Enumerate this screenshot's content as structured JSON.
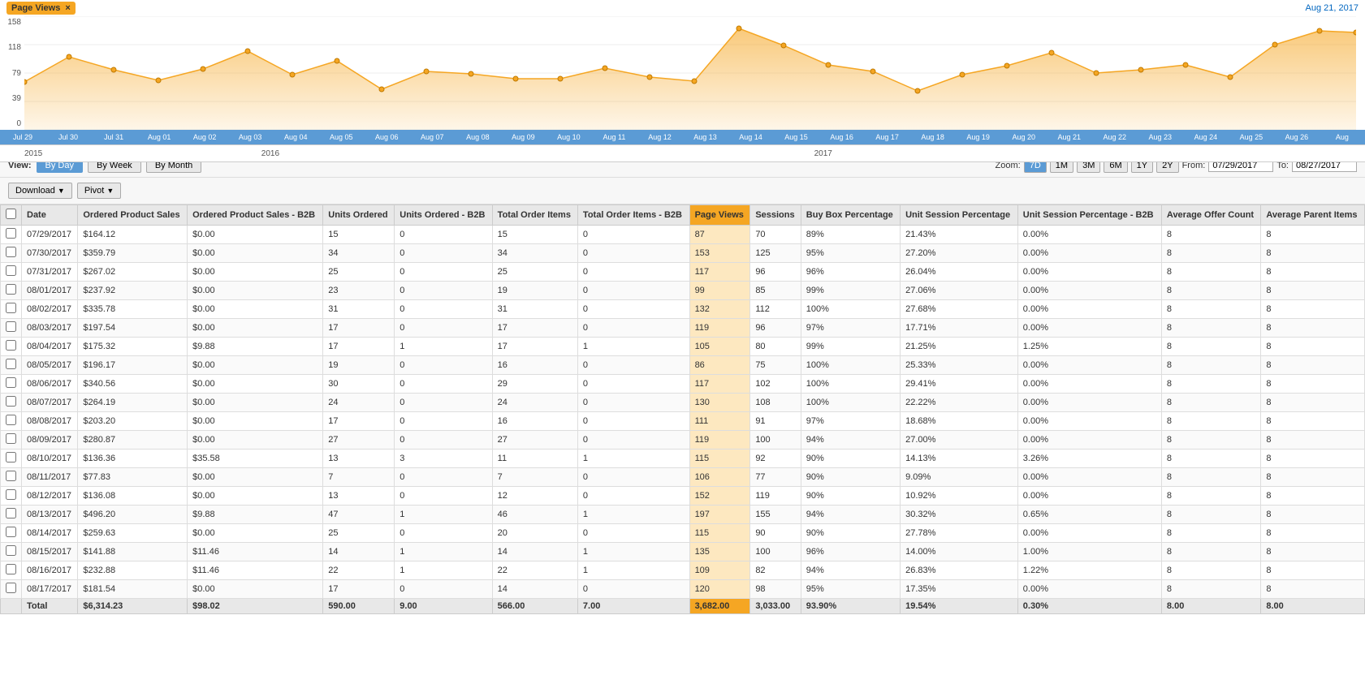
{
  "header": {
    "badge_label": "Page Views",
    "badge_close": "×",
    "date": "Aug 21, 2017"
  },
  "chart": {
    "y_labels": [
      "158",
      "118",
      "79",
      "39",
      "0"
    ],
    "x_labels": [
      "Jul 29",
      "Jul 30",
      "Jul 31",
      "Aug 01",
      "Aug 02",
      "Aug 03",
      "Aug 04",
      "Aug 05",
      "Aug 06",
      "Aug 07",
      "Aug 08",
      "Aug 09",
      "Aug 10",
      "Aug 11",
      "Aug 12",
      "Aug 13",
      "Aug 14",
      "Aug 15",
      "Aug 16",
      "Aug 17",
      "Aug 18",
      "Aug 19",
      "Aug 20",
      "Aug 21",
      "Aug 22",
      "Aug 23",
      "Aug 24",
      "Aug 25",
      "Aug 26",
      "Aug"
    ]
  },
  "year_axis": {
    "years": [
      {
        "label": "2015",
        "width": "18%"
      },
      {
        "label": "2016",
        "width": "42%"
      },
      {
        "label": "2017",
        "width": "38%"
      }
    ]
  },
  "view": {
    "label": "View:",
    "buttons": [
      {
        "label": "By Day",
        "active": true
      },
      {
        "label": "By Week",
        "active": false
      },
      {
        "label": "By Month",
        "active": false
      }
    ]
  },
  "zoom": {
    "label": "Zoom:",
    "buttons": [
      {
        "label": "7D",
        "active": true
      },
      {
        "label": "1M",
        "active": false
      },
      {
        "label": "3M",
        "active": false
      },
      {
        "label": "6M",
        "active": false
      },
      {
        "label": "1Y",
        "active": false
      },
      {
        "label": "2Y",
        "active": false
      }
    ],
    "from_label": "From:",
    "from_value": "07/29/2017",
    "to_label": "To:",
    "to_value": "08/27/2017"
  },
  "toolbar": {
    "download_label": "Download",
    "pivot_label": "Pivot"
  },
  "table": {
    "columns": [
      {
        "key": "check",
        "label": "",
        "highlight": false
      },
      {
        "key": "date",
        "label": "Date",
        "highlight": false
      },
      {
        "key": "ordered_product_sales",
        "label": "Ordered Product Sales",
        "highlight": false
      },
      {
        "key": "ordered_product_sales_b2b",
        "label": "Ordered Product Sales - B2B",
        "highlight": false
      },
      {
        "key": "units_ordered",
        "label": "Units Ordered",
        "highlight": false
      },
      {
        "key": "units_ordered_b2b",
        "label": "Units Ordered - B2B",
        "highlight": false
      },
      {
        "key": "total_order_items",
        "label": "Total Order Items",
        "highlight": false
      },
      {
        "key": "total_order_items_b2b",
        "label": "Total Order Items - B2B",
        "highlight": false
      },
      {
        "key": "page_views",
        "label": "Page Views",
        "highlight": true
      },
      {
        "key": "sessions",
        "label": "Sessions",
        "highlight": false
      },
      {
        "key": "buy_box_percentage",
        "label": "Buy Box Percentage",
        "highlight": false
      },
      {
        "key": "unit_session_percentage",
        "label": "Unit Session Percentage",
        "highlight": false
      },
      {
        "key": "unit_session_percentage_b2b",
        "label": "Unit Session Percentage - B2B",
        "highlight": false
      },
      {
        "key": "average_offer_count",
        "label": "Average Offer Count",
        "highlight": false
      },
      {
        "key": "average_parent_items",
        "label": "Average Parent Items",
        "highlight": false
      }
    ],
    "rows": [
      {
        "date": "07/29/2017",
        "ordered_product_sales": "$164.12",
        "ordered_product_sales_b2b": "$0.00",
        "units_ordered": "15",
        "units_ordered_b2b": "0",
        "total_order_items": "15",
        "total_order_items_b2b": "0",
        "page_views": "87",
        "sessions": "70",
        "buy_box_percentage": "89%",
        "unit_session_percentage": "21.43%",
        "unit_session_percentage_b2b": "0.00%",
        "average_offer_count": "8",
        "average_parent_items": "8"
      },
      {
        "date": "07/30/2017",
        "ordered_product_sales": "$359.79",
        "ordered_product_sales_b2b": "$0.00",
        "units_ordered": "34",
        "units_ordered_b2b": "0",
        "total_order_items": "34",
        "total_order_items_b2b": "0",
        "page_views": "153",
        "sessions": "125",
        "buy_box_percentage": "95%",
        "unit_session_percentage": "27.20%",
        "unit_session_percentage_b2b": "0.00%",
        "average_offer_count": "8",
        "average_parent_items": "8"
      },
      {
        "date": "07/31/2017",
        "ordered_product_sales": "$267.02",
        "ordered_product_sales_b2b": "$0.00",
        "units_ordered": "25",
        "units_ordered_b2b": "0",
        "total_order_items": "25",
        "total_order_items_b2b": "0",
        "page_views": "117",
        "sessions": "96",
        "buy_box_percentage": "96%",
        "unit_session_percentage": "26.04%",
        "unit_session_percentage_b2b": "0.00%",
        "average_offer_count": "8",
        "average_parent_items": "8"
      },
      {
        "date": "08/01/2017",
        "ordered_product_sales": "$237.92",
        "ordered_product_sales_b2b": "$0.00",
        "units_ordered": "23",
        "units_ordered_b2b": "0",
        "total_order_items": "19",
        "total_order_items_b2b": "0",
        "page_views": "99",
        "sessions": "85",
        "buy_box_percentage": "99%",
        "unit_session_percentage": "27.06%",
        "unit_session_percentage_b2b": "0.00%",
        "average_offer_count": "8",
        "average_parent_items": "8"
      },
      {
        "date": "08/02/2017",
        "ordered_product_sales": "$335.78",
        "ordered_product_sales_b2b": "$0.00",
        "units_ordered": "31",
        "units_ordered_b2b": "0",
        "total_order_items": "31",
        "total_order_items_b2b": "0",
        "page_views": "132",
        "sessions": "112",
        "buy_box_percentage": "100%",
        "unit_session_percentage": "27.68%",
        "unit_session_percentage_b2b": "0.00%",
        "average_offer_count": "8",
        "average_parent_items": "8"
      },
      {
        "date": "08/03/2017",
        "ordered_product_sales": "$197.54",
        "ordered_product_sales_b2b": "$0.00",
        "units_ordered": "17",
        "units_ordered_b2b": "0",
        "total_order_items": "17",
        "total_order_items_b2b": "0",
        "page_views": "119",
        "sessions": "96",
        "buy_box_percentage": "97%",
        "unit_session_percentage": "17.71%",
        "unit_session_percentage_b2b": "0.00%",
        "average_offer_count": "8",
        "average_parent_items": "8"
      },
      {
        "date": "08/04/2017",
        "ordered_product_sales": "$175.32",
        "ordered_product_sales_b2b": "$9.88",
        "units_ordered": "17",
        "units_ordered_b2b": "1",
        "total_order_items": "17",
        "total_order_items_b2b": "1",
        "page_views": "105",
        "sessions": "80",
        "buy_box_percentage": "99%",
        "unit_session_percentage": "21.25%",
        "unit_session_percentage_b2b": "1.25%",
        "average_offer_count": "8",
        "average_parent_items": "8"
      },
      {
        "date": "08/05/2017",
        "ordered_product_sales": "$196.17",
        "ordered_product_sales_b2b": "$0.00",
        "units_ordered": "19",
        "units_ordered_b2b": "0",
        "total_order_items": "16",
        "total_order_items_b2b": "0",
        "page_views": "86",
        "sessions": "75",
        "buy_box_percentage": "100%",
        "unit_session_percentage": "25.33%",
        "unit_session_percentage_b2b": "0.00%",
        "average_offer_count": "8",
        "average_parent_items": "8"
      },
      {
        "date": "08/06/2017",
        "ordered_product_sales": "$340.56",
        "ordered_product_sales_b2b": "$0.00",
        "units_ordered": "30",
        "units_ordered_b2b": "0",
        "total_order_items": "29",
        "total_order_items_b2b": "0",
        "page_views": "117",
        "sessions": "102",
        "buy_box_percentage": "100%",
        "unit_session_percentage": "29.41%",
        "unit_session_percentage_b2b": "0.00%",
        "average_offer_count": "8",
        "average_parent_items": "8"
      },
      {
        "date": "08/07/2017",
        "ordered_product_sales": "$264.19",
        "ordered_product_sales_b2b": "$0.00",
        "units_ordered": "24",
        "units_ordered_b2b": "0",
        "total_order_items": "24",
        "total_order_items_b2b": "0",
        "page_views": "130",
        "sessions": "108",
        "buy_box_percentage": "100%",
        "unit_session_percentage": "22.22%",
        "unit_session_percentage_b2b": "0.00%",
        "average_offer_count": "8",
        "average_parent_items": "8"
      },
      {
        "date": "08/08/2017",
        "ordered_product_sales": "$203.20",
        "ordered_product_sales_b2b": "$0.00",
        "units_ordered": "17",
        "units_ordered_b2b": "0",
        "total_order_items": "16",
        "total_order_items_b2b": "0",
        "page_views": "111",
        "sessions": "91",
        "buy_box_percentage": "97%",
        "unit_session_percentage": "18.68%",
        "unit_session_percentage_b2b": "0.00%",
        "average_offer_count": "8",
        "average_parent_items": "8"
      },
      {
        "date": "08/09/2017",
        "ordered_product_sales": "$280.87",
        "ordered_product_sales_b2b": "$0.00",
        "units_ordered": "27",
        "units_ordered_b2b": "0",
        "total_order_items": "27",
        "total_order_items_b2b": "0",
        "page_views": "119",
        "sessions": "100",
        "buy_box_percentage": "94%",
        "unit_session_percentage": "27.00%",
        "unit_session_percentage_b2b": "0.00%",
        "average_offer_count": "8",
        "average_parent_items": "8"
      },
      {
        "date": "08/10/2017",
        "ordered_product_sales": "$136.36",
        "ordered_product_sales_b2b": "$35.58",
        "units_ordered": "13",
        "units_ordered_b2b": "3",
        "total_order_items": "11",
        "total_order_items_b2b": "1",
        "page_views": "115",
        "sessions": "92",
        "buy_box_percentage": "90%",
        "unit_session_percentage": "14.13%",
        "unit_session_percentage_b2b": "3.26%",
        "average_offer_count": "8",
        "average_parent_items": "8"
      },
      {
        "date": "08/11/2017",
        "ordered_product_sales": "$77.83",
        "ordered_product_sales_b2b": "$0.00",
        "units_ordered": "7",
        "units_ordered_b2b": "0",
        "total_order_items": "7",
        "total_order_items_b2b": "0",
        "page_views": "106",
        "sessions": "77",
        "buy_box_percentage": "90%",
        "unit_session_percentage": "9.09%",
        "unit_session_percentage_b2b": "0.00%",
        "average_offer_count": "8",
        "average_parent_items": "8"
      },
      {
        "date": "08/12/2017",
        "ordered_product_sales": "$136.08",
        "ordered_product_sales_b2b": "$0.00",
        "units_ordered": "13",
        "units_ordered_b2b": "0",
        "total_order_items": "12",
        "total_order_items_b2b": "0",
        "page_views": "152",
        "sessions": "119",
        "buy_box_percentage": "90%",
        "unit_session_percentage": "10.92%",
        "unit_session_percentage_b2b": "0.00%",
        "average_offer_count": "8",
        "average_parent_items": "8"
      },
      {
        "date": "08/13/2017",
        "ordered_product_sales": "$496.20",
        "ordered_product_sales_b2b": "$9.88",
        "units_ordered": "47",
        "units_ordered_b2b": "1",
        "total_order_items": "46",
        "total_order_items_b2b": "1",
        "page_views": "197",
        "sessions": "155",
        "buy_box_percentage": "94%",
        "unit_session_percentage": "30.32%",
        "unit_session_percentage_b2b": "0.65%",
        "average_offer_count": "8",
        "average_parent_items": "8"
      },
      {
        "date": "08/14/2017",
        "ordered_product_sales": "$259.63",
        "ordered_product_sales_b2b": "$0.00",
        "units_ordered": "25",
        "units_ordered_b2b": "0",
        "total_order_items": "20",
        "total_order_items_b2b": "0",
        "page_views": "115",
        "sessions": "90",
        "buy_box_percentage": "90%",
        "unit_session_percentage": "27.78%",
        "unit_session_percentage_b2b": "0.00%",
        "average_offer_count": "8",
        "average_parent_items": "8"
      },
      {
        "date": "08/15/2017",
        "ordered_product_sales": "$141.88",
        "ordered_product_sales_b2b": "$11.46",
        "units_ordered": "14",
        "units_ordered_b2b": "1",
        "total_order_items": "14",
        "total_order_items_b2b": "1",
        "page_views": "135",
        "sessions": "100",
        "buy_box_percentage": "96%",
        "unit_session_percentage": "14.00%",
        "unit_session_percentage_b2b": "1.00%",
        "average_offer_count": "8",
        "average_parent_items": "8"
      },
      {
        "date": "08/16/2017",
        "ordered_product_sales": "$232.88",
        "ordered_product_sales_b2b": "$11.46",
        "units_ordered": "22",
        "units_ordered_b2b": "1",
        "total_order_items": "22",
        "total_order_items_b2b": "1",
        "page_views": "109",
        "sessions": "82",
        "buy_box_percentage": "94%",
        "unit_session_percentage": "26.83%",
        "unit_session_percentage_b2b": "1.22%",
        "average_offer_count": "8",
        "average_parent_items": "8"
      },
      {
        "date": "08/17/2017",
        "ordered_product_sales": "$181.54",
        "ordered_product_sales_b2b": "$0.00",
        "units_ordered": "17",
        "units_ordered_b2b": "0",
        "total_order_items": "14",
        "total_order_items_b2b": "0",
        "page_views": "120",
        "sessions": "98",
        "buy_box_percentage": "95%",
        "unit_session_percentage": "17.35%",
        "unit_session_percentage_b2b": "0.00%",
        "average_offer_count": "8",
        "average_parent_items": "8"
      }
    ],
    "footer": {
      "label": "Total",
      "ordered_product_sales": "$6,314.23",
      "ordered_product_sales_b2b": "$98.02",
      "units_ordered": "590.00",
      "units_ordered_b2b": "9.00",
      "total_order_items": "566.00",
      "total_order_items_b2b": "7.00",
      "page_views": "3,682.00",
      "sessions": "3,033.00",
      "buy_box_percentage": "93.90%",
      "unit_session_percentage": "19.54%",
      "unit_session_percentage_b2b": "0.30%",
      "average_offer_count": "8.00",
      "average_parent_items": "8.00"
    }
  }
}
